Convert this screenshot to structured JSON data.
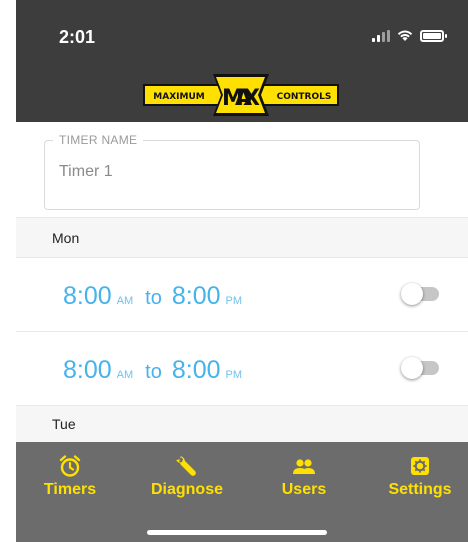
{
  "status": {
    "time": "2:01"
  },
  "brand": {
    "left": "MAXIMUM",
    "center": "MAX",
    "right": "CONTROLS",
    "accent": "#ffe000"
  },
  "form": {
    "timer_name_label": "TIMER NAME",
    "timer_name_value": "Timer 1"
  },
  "schedule": {
    "days": [
      {
        "label": "Mon"
      },
      {
        "label": "Tue"
      }
    ],
    "entries": [
      {
        "start": "8:00",
        "start_ampm": "AM",
        "sep": "to",
        "end": "8:00",
        "end_ampm": "PM",
        "enabled": false
      },
      {
        "start": "8:00",
        "start_ampm": "AM",
        "sep": "to",
        "end": "8:00",
        "end_ampm": "PM",
        "enabled": false
      }
    ]
  },
  "tabs": [
    {
      "label": "Timers",
      "icon": "alarm-clock-icon"
    },
    {
      "label": "Diagnose",
      "icon": "wrench-icon"
    },
    {
      "label": "Users",
      "icon": "users-icon"
    },
    {
      "label": "Settings",
      "icon": "gear-icon"
    }
  ],
  "colors": {
    "header": "#3d3d3d",
    "time_blue": "#46b3ea",
    "tabbar": "#6c6c6c"
  }
}
